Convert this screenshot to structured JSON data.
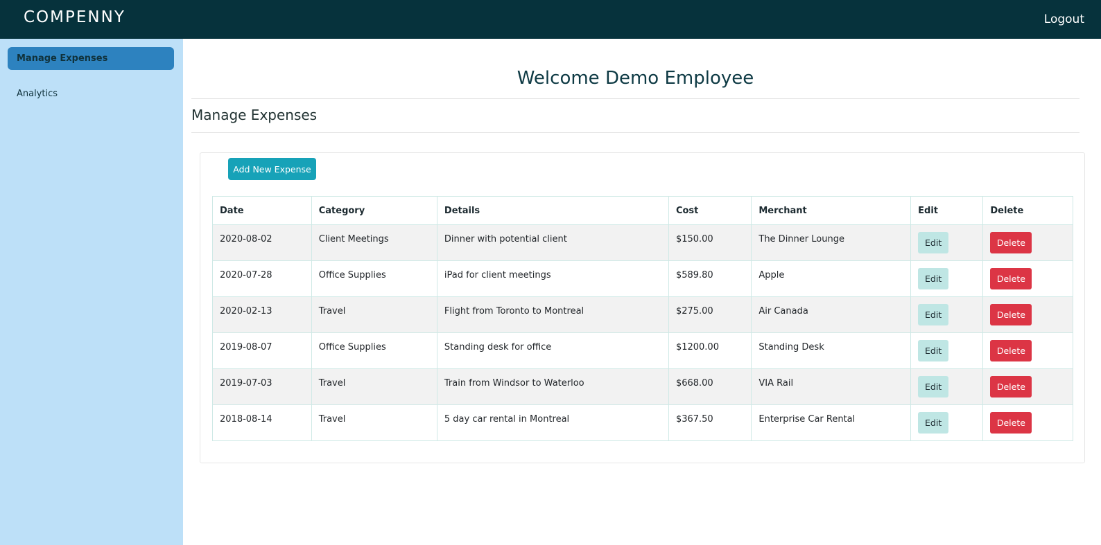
{
  "header": {
    "logo": "COMPENNY",
    "logout_label": "Logout"
  },
  "sidebar": {
    "items": [
      {
        "label": "Manage Expenses",
        "active": true
      },
      {
        "label": "Analytics",
        "active": false
      }
    ]
  },
  "main": {
    "welcome": "Welcome Demo Employee",
    "section_title": "Manage Expenses",
    "add_button_label": "Add New Expense",
    "table": {
      "columns": [
        "Date",
        "Category",
        "Details",
        "Cost",
        "Merchant",
        "Edit",
        "Delete"
      ],
      "edit_label": "Edit",
      "delete_label": "Delete",
      "rows": [
        {
          "date": "2020-08-02",
          "category": "Client Meetings",
          "details": "Dinner with potential client",
          "cost": "$150.00",
          "merchant": "The Dinner Lounge"
        },
        {
          "date": "2020-07-28",
          "category": "Office Supplies",
          "details": "iPad for client meetings",
          "cost": "$589.80",
          "merchant": "Apple"
        },
        {
          "date": "2020-02-13",
          "category": "Travel",
          "details": "Flight from Toronto to Montreal",
          "cost": "$275.00",
          "merchant": "Air Canada"
        },
        {
          "date": "2019-08-07",
          "category": "Office Supplies",
          "details": "Standing desk for office",
          "cost": "$1200.00",
          "merchant": "Standing Desk"
        },
        {
          "date": "2019-07-03",
          "category": "Travel",
          "details": "Train from Windsor to Waterloo",
          "cost": "$668.00",
          "merchant": "VIA Rail"
        },
        {
          "date": "2018-08-14",
          "category": "Travel",
          "details": "5 day car rental in Montreal",
          "cost": "$367.50",
          "merchant": "Enterprise Car Rental"
        }
      ]
    }
  },
  "colors": {
    "topbar": "#06323c",
    "sidebar": "#bde0f8",
    "sidebar_active": "#2d82bf",
    "add_button": "#17a2b8",
    "edit_button": "#bfe6e4",
    "delete_button": "#dc3545"
  }
}
